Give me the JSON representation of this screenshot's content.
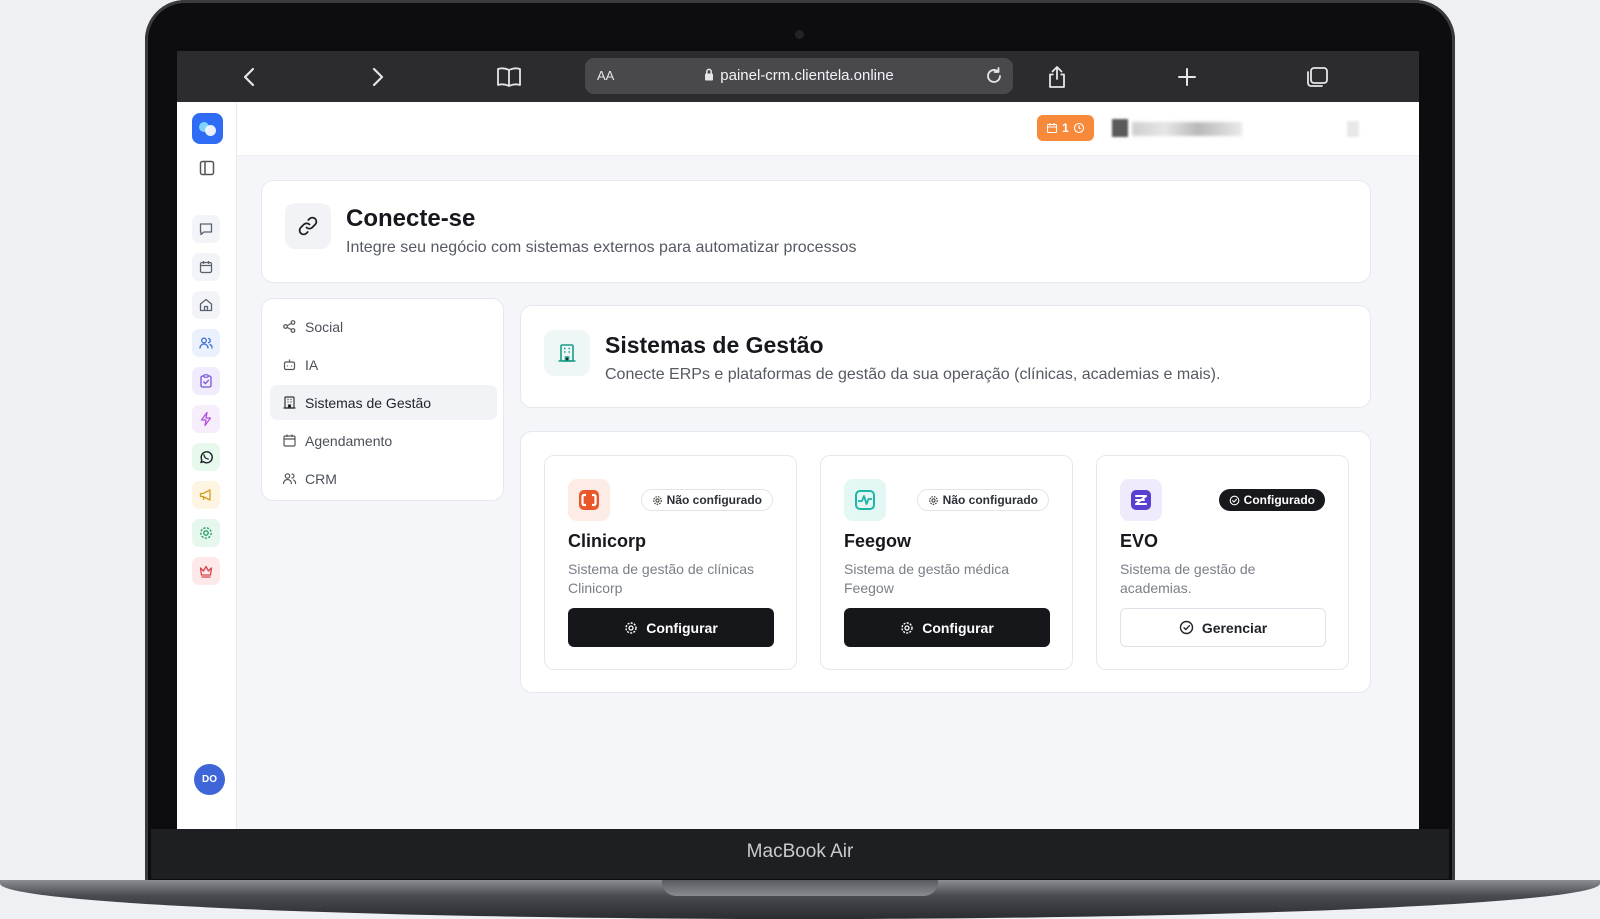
{
  "device": {
    "label": "MacBook Air"
  },
  "browser": {
    "aa_label": "AA",
    "url": "painel-crm.clientela.online"
  },
  "topbar": {
    "notification_count": "1"
  },
  "user": {
    "initials": "DO"
  },
  "hero": {
    "title": "Conecte-se",
    "subtitle": "Integre seu negócio com sistemas externos para automatizar processos"
  },
  "nav": {
    "items": [
      {
        "label": "Social",
        "icon": "share-icon"
      },
      {
        "label": "IA",
        "icon": "bot-icon"
      },
      {
        "label": "Sistemas de Gestão",
        "icon": "building-icon",
        "active": true
      },
      {
        "label": "Agendamento",
        "icon": "calendar-icon"
      },
      {
        "label": "CRM",
        "icon": "users-icon"
      }
    ]
  },
  "section": {
    "title": "Sistemas de Gestão",
    "subtitle": "Conecte ERPs e plataformas de gestão da sua operação (clínicas, academias e mais)."
  },
  "integrations": [
    {
      "name": "Clinicorp",
      "status": "Não configurado",
      "description": "Sistema de gestão de clínicas Clinicorp",
      "button": "Configurar",
      "color": "#e8582a"
    },
    {
      "name": "Feegow",
      "status": "Não configurado",
      "description": "Sistema de gestão médica Feegow",
      "button": "Configurar",
      "color": "#1fb5a5"
    },
    {
      "name": "EVO",
      "status": "Configurado",
      "description": "Sistema de gestão de academias.",
      "button": "Gerenciar",
      "color": "#5b3fcf"
    }
  ],
  "colors": {
    "brand": "#2f6cf6",
    "notification": "#f6893a",
    "primary_button": "#16171a"
  }
}
